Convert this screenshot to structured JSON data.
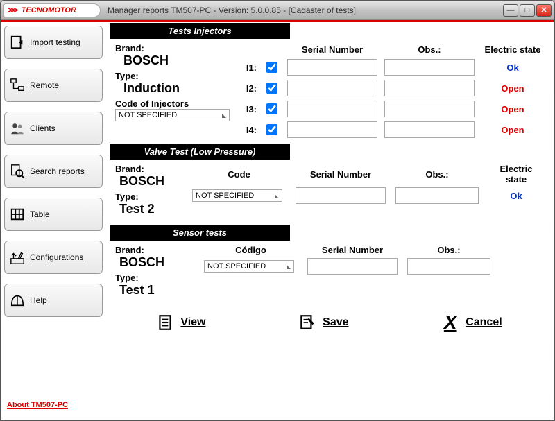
{
  "window": {
    "logo": "TECNOMOTOR",
    "title": "Manager reports TM507-PC - Version: 5.0.0.85 - [Cadaster of tests]"
  },
  "sidebar": {
    "items": [
      {
        "label": "Import testing"
      },
      {
        "label": "Remote"
      },
      {
        "label": "Clients"
      },
      {
        "label": "Search reports"
      },
      {
        "label": "Table"
      },
      {
        "label": "Configurations"
      },
      {
        "label": "Help"
      }
    ],
    "about": "About TM507-PC"
  },
  "sections": {
    "injectors": {
      "title": "Tests Injectors",
      "brand_label": "Brand:",
      "brand": "BOSCH",
      "type_label": "Type:",
      "type": "Induction",
      "code_label": "Code of Injectors",
      "code_value": "NOT SPECIFIED",
      "serial_header": "Serial Number",
      "obs_header": "Obs.:",
      "state_header": "Electric state",
      "rows": [
        {
          "label": "I1:",
          "serial": "",
          "obs": "",
          "state": "Ok",
          "state_class": "ok"
        },
        {
          "label": "I2:",
          "serial": "",
          "obs": "",
          "state": "Open",
          "state_class": "open"
        },
        {
          "label": "I3:",
          "serial": "",
          "obs": "",
          "state": "Open",
          "state_class": "open"
        },
        {
          "label": "I4:",
          "serial": "",
          "obs": "",
          "state": "Open",
          "state_class": "open"
        }
      ]
    },
    "valve": {
      "title": "Valve Test (Low Pressure)",
      "brand_label": "Brand:",
      "brand": "BOSCH",
      "type_label": "Type:",
      "type": "Test 2",
      "code_header": "Code",
      "code_value": "NOT SPECIFIED",
      "serial_header": "Serial Number",
      "serial": "",
      "obs_header": "Obs.:",
      "obs": "",
      "state_header": "Electric state",
      "state": "Ok"
    },
    "sensor": {
      "title": "Sensor tests",
      "brand_label": "Brand:",
      "brand": "BOSCH",
      "type_label": "Type:",
      "type": "Test 1",
      "code_header": "Código",
      "code_value": "NOT SPECIFIED",
      "serial_header": "Serial Number",
      "serial": "",
      "obs_header": "Obs.:",
      "obs": ""
    }
  },
  "actions": {
    "view": "View",
    "save": "Save",
    "cancel": "Cancel"
  }
}
